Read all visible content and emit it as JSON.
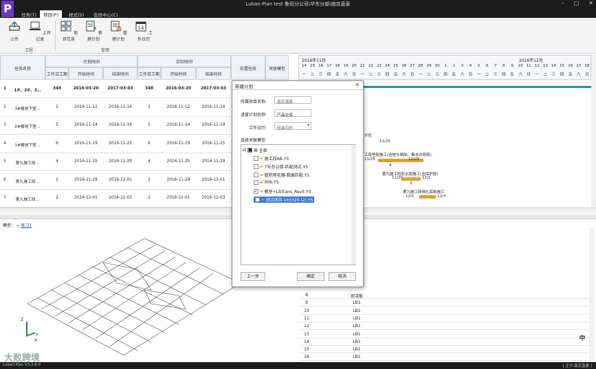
{
  "window": {
    "logo_letter": "P",
    "title": "Luban Plan test 鲁班分公司\\华东分部\\南京直家",
    "minimize": "–",
    "maximize": "□",
    "close": "✕"
  },
  "menu": {
    "tabs": [
      {
        "label": "任务(T)"
      },
      {
        "label": "项目(P)"
      },
      {
        "label": "样式(S)"
      },
      {
        "label": "会员中心(C)"
      }
    ]
  },
  "ribbon": {
    "buttons": [
      {
        "label": "上传"
      },
      {
        "label": "上传记录"
      },
      {
        "label": "项目信息"
      },
      {
        "label": "新建计划"
      },
      {
        "label": "管理计划"
      },
      {
        "label": "工作日历"
      }
    ],
    "groups": [
      {
        "label": "工程"
      },
      {
        "label": "管理"
      }
    ],
    "calendar_day": "14"
  },
  "task_grid": {
    "header": {
      "task_name": "任务名称",
      "plan_time": "计划时间",
      "actual_time": "实际时间",
      "work_days": "工作日工期",
      "start_date": "开始时间",
      "end_date": "结束时间",
      "pre_task": "前置任务",
      "linked_model": "关联模型"
    },
    "rows": [
      {
        "no": "1",
        "name": "1#、2#、3…",
        "plan_days": "348",
        "plan_start": "2016-03-20",
        "plan_end": "2017-03-03",
        "act_days": "348",
        "act_start": "2016-03-20",
        "act_end": "2017-03-03"
      },
      {
        "no": "2",
        "name": "3#楼地下室…",
        "plan_days": "2",
        "plan_start": "2016-11-12",
        "plan_end": "2016-11-14",
        "act_days": "2",
        "act_start": "2016-11-12",
        "act_end": "2016-11-14"
      },
      {
        "no": "3",
        "name": "2#楼地下室…",
        "plan_days": "5",
        "plan_start": "2016-11-14",
        "plan_end": "2016-11-19",
        "act_days": "5",
        "act_start": "2016-11-14",
        "act_end": "2016-11-19"
      },
      {
        "no": "4",
        "name": "1#楼地下室…",
        "plan_days": "6",
        "plan_start": "2016-11-19",
        "plan_end": "2016-11-25",
        "act_days": "6",
        "act_start": "2016-11-19",
        "act_end": "2016-11-25"
      },
      {
        "no": "5",
        "name": "第九施工段…",
        "plan_days": "4",
        "plan_start": "2016-11-25",
        "plan_end": "2016-11-29",
        "act_days": "4",
        "act_start": "2016-11-25",
        "act_end": "2016-11-29"
      },
      {
        "no": "6",
        "name": "第九施工段…",
        "plan_days": "2",
        "plan_start": "2016-11-29",
        "plan_end": "2016-12-01",
        "act_days": "2",
        "act_start": "2016-11-29",
        "act_end": "2016-12-01"
      },
      {
        "no": "7",
        "name": "第九施工段…",
        "plan_days": "2",
        "plan_start": "2016-12-01",
        "plan_end": "2016-12-03",
        "act_days": "2",
        "act_start": "2016-12-01",
        "act_end": "2016-12-03"
      }
    ]
  },
  "gantt": {
    "month_left": "2016年11月",
    "month_right": "2016年12月",
    "day_numbers": [
      "14",
      "15",
      "16",
      "17",
      "18",
      "19",
      "20",
      "21",
      "22",
      "23",
      "24",
      "25",
      "26",
      "27",
      "28",
      "29",
      "30",
      "1",
      "2",
      "3",
      "4",
      "5",
      "6",
      "7",
      "8",
      "9",
      "10",
      "11",
      "12",
      "13",
      "14",
      "15",
      "16",
      "17",
      "18"
    ],
    "weekdays": [
      "一",
      "二",
      "三",
      "四",
      "五",
      "六",
      "日",
      "一",
      "二",
      "三",
      "四",
      "五",
      "六",
      "日",
      "一",
      "二",
      "三",
      "四",
      "五",
      "六",
      "日",
      "一",
      "二",
      "三",
      "四",
      "五",
      "六",
      "日",
      "一",
      "二",
      "三",
      "四",
      "五",
      "六",
      "日"
    ],
    "labels": [
      {
        "text": "开挖"
      },
      {
        "text": "11/25"
      },
      {
        "text": "工段垫层施工(含桩头凿除、集水井砌筑)"
      },
      {
        "text": "11/25"
      },
      {
        "text": "11/29"
      },
      {
        "text": "4"
      },
      {
        "text": "第九施工段防水层施工(含保护层)"
      },
      {
        "text": "11/29"
      },
      {
        "text": "12/1"
      },
      {
        "text": "2"
      },
      {
        "text": "第九施工段绑扎底板施工"
      },
      {
        "text": "12/1"
      },
      {
        "text": "12/3"
      }
    ]
  },
  "dialog": {
    "title": "新建计划",
    "project_label": "所属项目名称:",
    "project_value": "南京直家",
    "plan_name_label": "进度计划名称:",
    "plan_name_value": "产品交底",
    "calendar_label": "工作日历:",
    "calendar_value": "标准日历",
    "model_label": "选择关联模型",
    "tree": [
      {
        "label": "全部",
        "checked": "■"
      },
      {
        "label": "施工段AB.YS",
        "checked": ""
      },
      {
        "label": "7号办公楼-匹配测试.YS",
        "checked": ""
      },
      {
        "label": "庭院喷花器-数据匹配.YS",
        "checked": ""
      },
      {
        "label": "006.YS",
        "checked": ""
      },
      {
        "label": "教室+LBTrans_Revit.YS",
        "checked": "✓"
      },
      {
        "label": "测试项目-161020 (2).YS",
        "checked": "✓"
      }
    ],
    "back_button": "上一步",
    "ok_button": "确定",
    "cancel_button": "取消"
  },
  "model_panel": {
    "label": "模型：",
    "link": "练习1",
    "axis_z": "Z",
    "axis_y": "Y",
    "axis_x": "X"
  },
  "bottom_grid": {
    "rows": [
      {
        "no": "8",
        "value": "现浇板"
      },
      {
        "no": "9",
        "value": "LB1"
      },
      {
        "no": "10",
        "value": "LB1"
      },
      {
        "no": "11",
        "value": "LB1"
      },
      {
        "no": "12",
        "value": "LB1"
      },
      {
        "no": "13",
        "value": "LB1"
      },
      {
        "no": "14",
        "value": "LB1"
      },
      {
        "no": "15",
        "value": "LB1"
      },
      {
        "no": "16",
        "value": "LB1"
      }
    ]
  },
  "statusbar": {
    "version": "Luban Plan V3.2.0.0",
    "right_text": "[ 王宁.南京直家 ]",
    "watermark": "大败跨境",
    "mascot_char": "中"
  },
  "colors": {
    "dark": "#1c1c1c",
    "accent": "#6a3dbf",
    "gantt_bar": "#e0a030",
    "progress": "#149ca0",
    "selection": "#3875d7"
  }
}
